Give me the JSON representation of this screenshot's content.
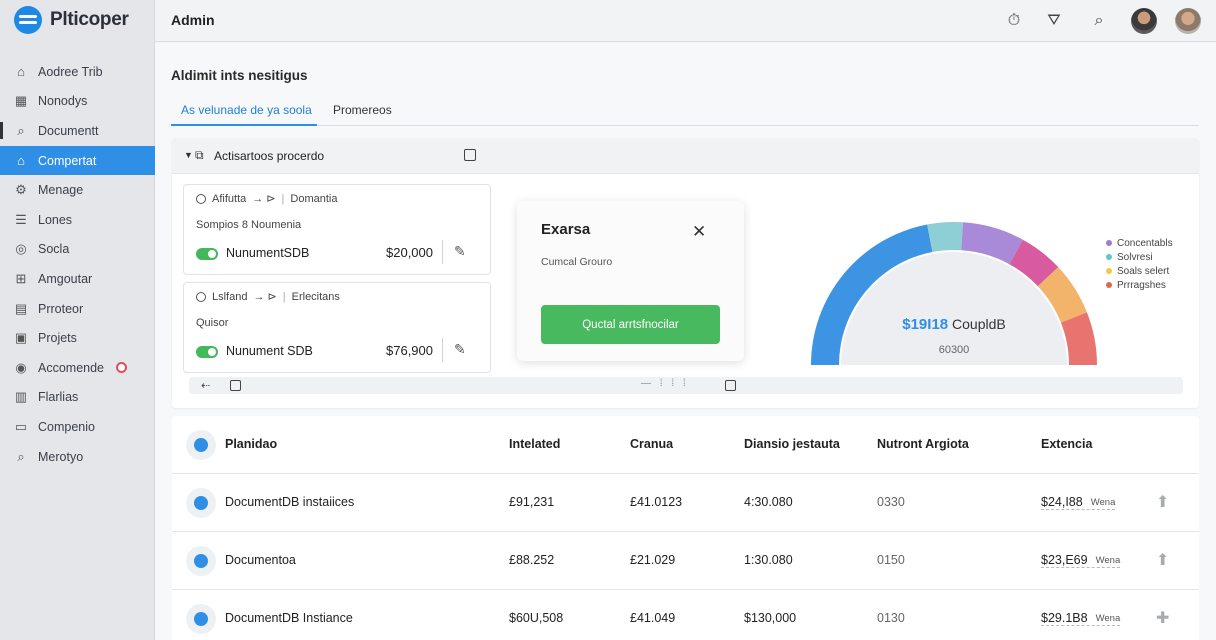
{
  "brand": {
    "name": "Plticoper"
  },
  "sidebar": {
    "items": [
      {
        "label": "Aodree Trib",
        "icon": "home-outline-icon"
      },
      {
        "label": "Nonodys",
        "icon": "building-icon"
      },
      {
        "label": "Documentt",
        "icon": "search-icon"
      },
      {
        "label": "Compertat",
        "icon": "home-icon"
      },
      {
        "label": "Menage",
        "icon": "gear-icon"
      },
      {
        "label": "Lones",
        "icon": "list-icon"
      },
      {
        "label": "Socla",
        "icon": "circle-icon"
      },
      {
        "label": "Amgoutar",
        "icon": "stack-icon"
      },
      {
        "label": "Prroteor",
        "icon": "grid-icon"
      },
      {
        "label": "Projets",
        "icon": "folder-icon"
      },
      {
        "label": "Accomende",
        "icon": "target-icon"
      },
      {
        "label": "Flarlias",
        "icon": "bars-icon"
      },
      {
        "label": "Compenio",
        "icon": "monitor-icon"
      },
      {
        "label": "Merotyo",
        "icon": "search-icon"
      }
    ]
  },
  "topbar": {
    "title": "Admin"
  },
  "main": {
    "heading": "Aldimit ints nesitigus",
    "tabs": [
      {
        "label": "As velunade de ya soola"
      },
      {
        "label": "Promereos"
      }
    ],
    "panel": {
      "title": "Actisartoos procerdo",
      "cards": [
        {
          "radio_label": "Afifutta",
          "arrows": "→ ⊳",
          "category": "Domantia",
          "subtitle": "Sompios 8 Noumenia",
          "name": "NunumentSDB",
          "amount": "$20,000"
        },
        {
          "radio_label": "Lslfand",
          "arrows": "→ ⊳",
          "category": "Erlecitans",
          "subtitle": "Quisor",
          "name": "Nunument SDB",
          "amount": "$76,900"
        }
      ],
      "modal": {
        "title": "Exarsa",
        "subtitle": "Cumcal Grouro",
        "button": "Quctal arrtsfnocilar"
      },
      "gauge": {
        "value": "$19I18",
        "label": "CoupldB",
        "sub": "60300",
        "segments": [
          {
            "color": "#3d94e3",
            "fraction": 0.44
          },
          {
            "color": "#8ecfd6",
            "fraction": 0.08
          },
          {
            "color": "#a88ad9",
            "fraction": 0.14
          },
          {
            "color": "#d85ba0",
            "fraction": 0.1
          },
          {
            "color": "#f2b46a",
            "fraction": 0.12
          },
          {
            "color": "#e87470",
            "fraction": 0.12
          }
        ]
      },
      "legend": [
        {
          "label": "Concentabls",
          "color": "#9b7bd6"
        },
        {
          "label": "Solvresi",
          "color": "#5ec8c8"
        },
        {
          "label": "Soals selert",
          "color": "#f2c84b"
        },
        {
          "label": "Prrragshes",
          "color": "#e0674c"
        }
      ]
    },
    "table": {
      "headers": [
        "Planidao",
        "Intelated",
        "Cranua",
        "Diansio jestauta",
        "Nutront Argiota",
        "Extencia"
      ],
      "rows": [
        {
          "name": "DocumentDB instaiices",
          "c1": "£91,231",
          "c2": "£41.0123",
          "c3": "4:30.080",
          "c4": "0330",
          "ext": "$24,I88",
          "tag": "Wena",
          "arrow": "⬆"
        },
        {
          "name": "Documentoa",
          "c1": "£88.252",
          "c2": "£21.029",
          "c3": "1:30.080",
          "c4": "0150",
          "ext": "$23,E69",
          "tag": "Wena",
          "arrow": "⬆"
        },
        {
          "name": "DocumentDB Instiance",
          "c1": "$60U,508",
          "c2": "£41.049",
          "c3": "$130,000",
          "c4": "0130",
          "ext": "$29.1B8",
          "tag": "Wena",
          "arrow": "✚"
        }
      ]
    }
  }
}
